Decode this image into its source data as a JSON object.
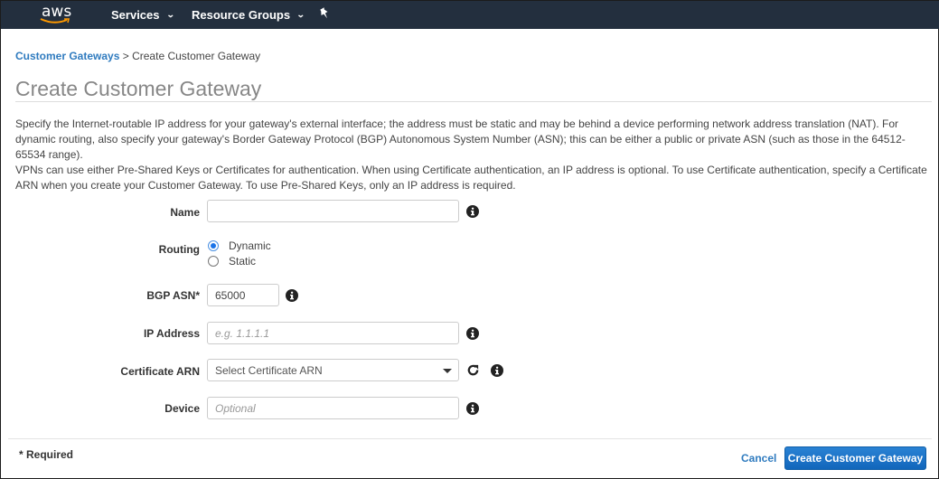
{
  "topnav": {
    "logo_text": "aws",
    "services_label": "Services",
    "resource_groups_label": "Resource Groups",
    "pin_icon": "pin-icon"
  },
  "breadcrumb": {
    "parent": "Customer Gateways",
    "separator": ">",
    "current": "Create Customer Gateway"
  },
  "page": {
    "title": "Create Customer Gateway",
    "description_1": "Specify the Internet-routable IP address for your gateway's external interface; the address must be static and may be behind a device performing network address translation (NAT). For dynamic routing, also specify your gateway's Border Gateway Protocol (BGP) Autonomous System Number (ASN); this can be either a public or private ASN (such as those in the 64512-65534 range).",
    "description_2": "VPNs can use either Pre-Shared Keys or Certificates for authentication. When using Certificate authentication, an IP address is optional. To use Certificate authentication, specify a Certificate ARN when you create your Customer Gateway. To use Pre-Shared Keys, only an IP address is required."
  },
  "form": {
    "name": {
      "label": "Name",
      "value": "",
      "placeholder": ""
    },
    "routing": {
      "label": "Routing",
      "options": [
        {
          "label": "Dynamic",
          "selected": true
        },
        {
          "label": "Static",
          "selected": false
        }
      ]
    },
    "bgp_asn": {
      "label": "BGP ASN*",
      "value": "65000"
    },
    "ip_address": {
      "label": "IP Address",
      "value": "",
      "placeholder": "e.g. 1.1.1.1"
    },
    "certificate_arn": {
      "label": "Certificate ARN",
      "selected": "Select Certificate ARN"
    },
    "device": {
      "label": "Device",
      "value": "",
      "placeholder": "Optional"
    }
  },
  "footer": {
    "required_note": "* Required",
    "cancel_label": "Cancel",
    "create_label": "Create Customer Gateway"
  },
  "colors": {
    "nav_bg": "#232f3e",
    "link": "#2f7bbf",
    "primary_button": "#1a72c5"
  }
}
